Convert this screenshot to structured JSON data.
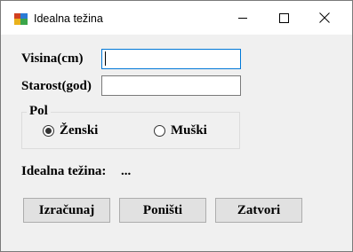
{
  "window": {
    "title": "Idealna težina",
    "controls": {
      "minimize_icon": "minimize-icon",
      "maximize_icon": "maximize-icon",
      "close_icon": "close-icon"
    }
  },
  "form": {
    "height_label": "Visina(cm)",
    "height_value": "",
    "age_label": "Starost(god)",
    "age_value": "",
    "gender_group_label": "Pol",
    "gender_options": [
      {
        "label": "Ženski",
        "selected": true
      },
      {
        "label": "Muški",
        "selected": false
      }
    ],
    "result_label": "Idealna težina:",
    "result_value": "..."
  },
  "buttons": {
    "calculate": "Izračunaj",
    "reset": "Poništi",
    "close": "Zatvori"
  },
  "colors": {
    "focus_border": "#0078d7",
    "window_bg": "#f0f0f0",
    "button_bg": "#e1e1e1"
  }
}
